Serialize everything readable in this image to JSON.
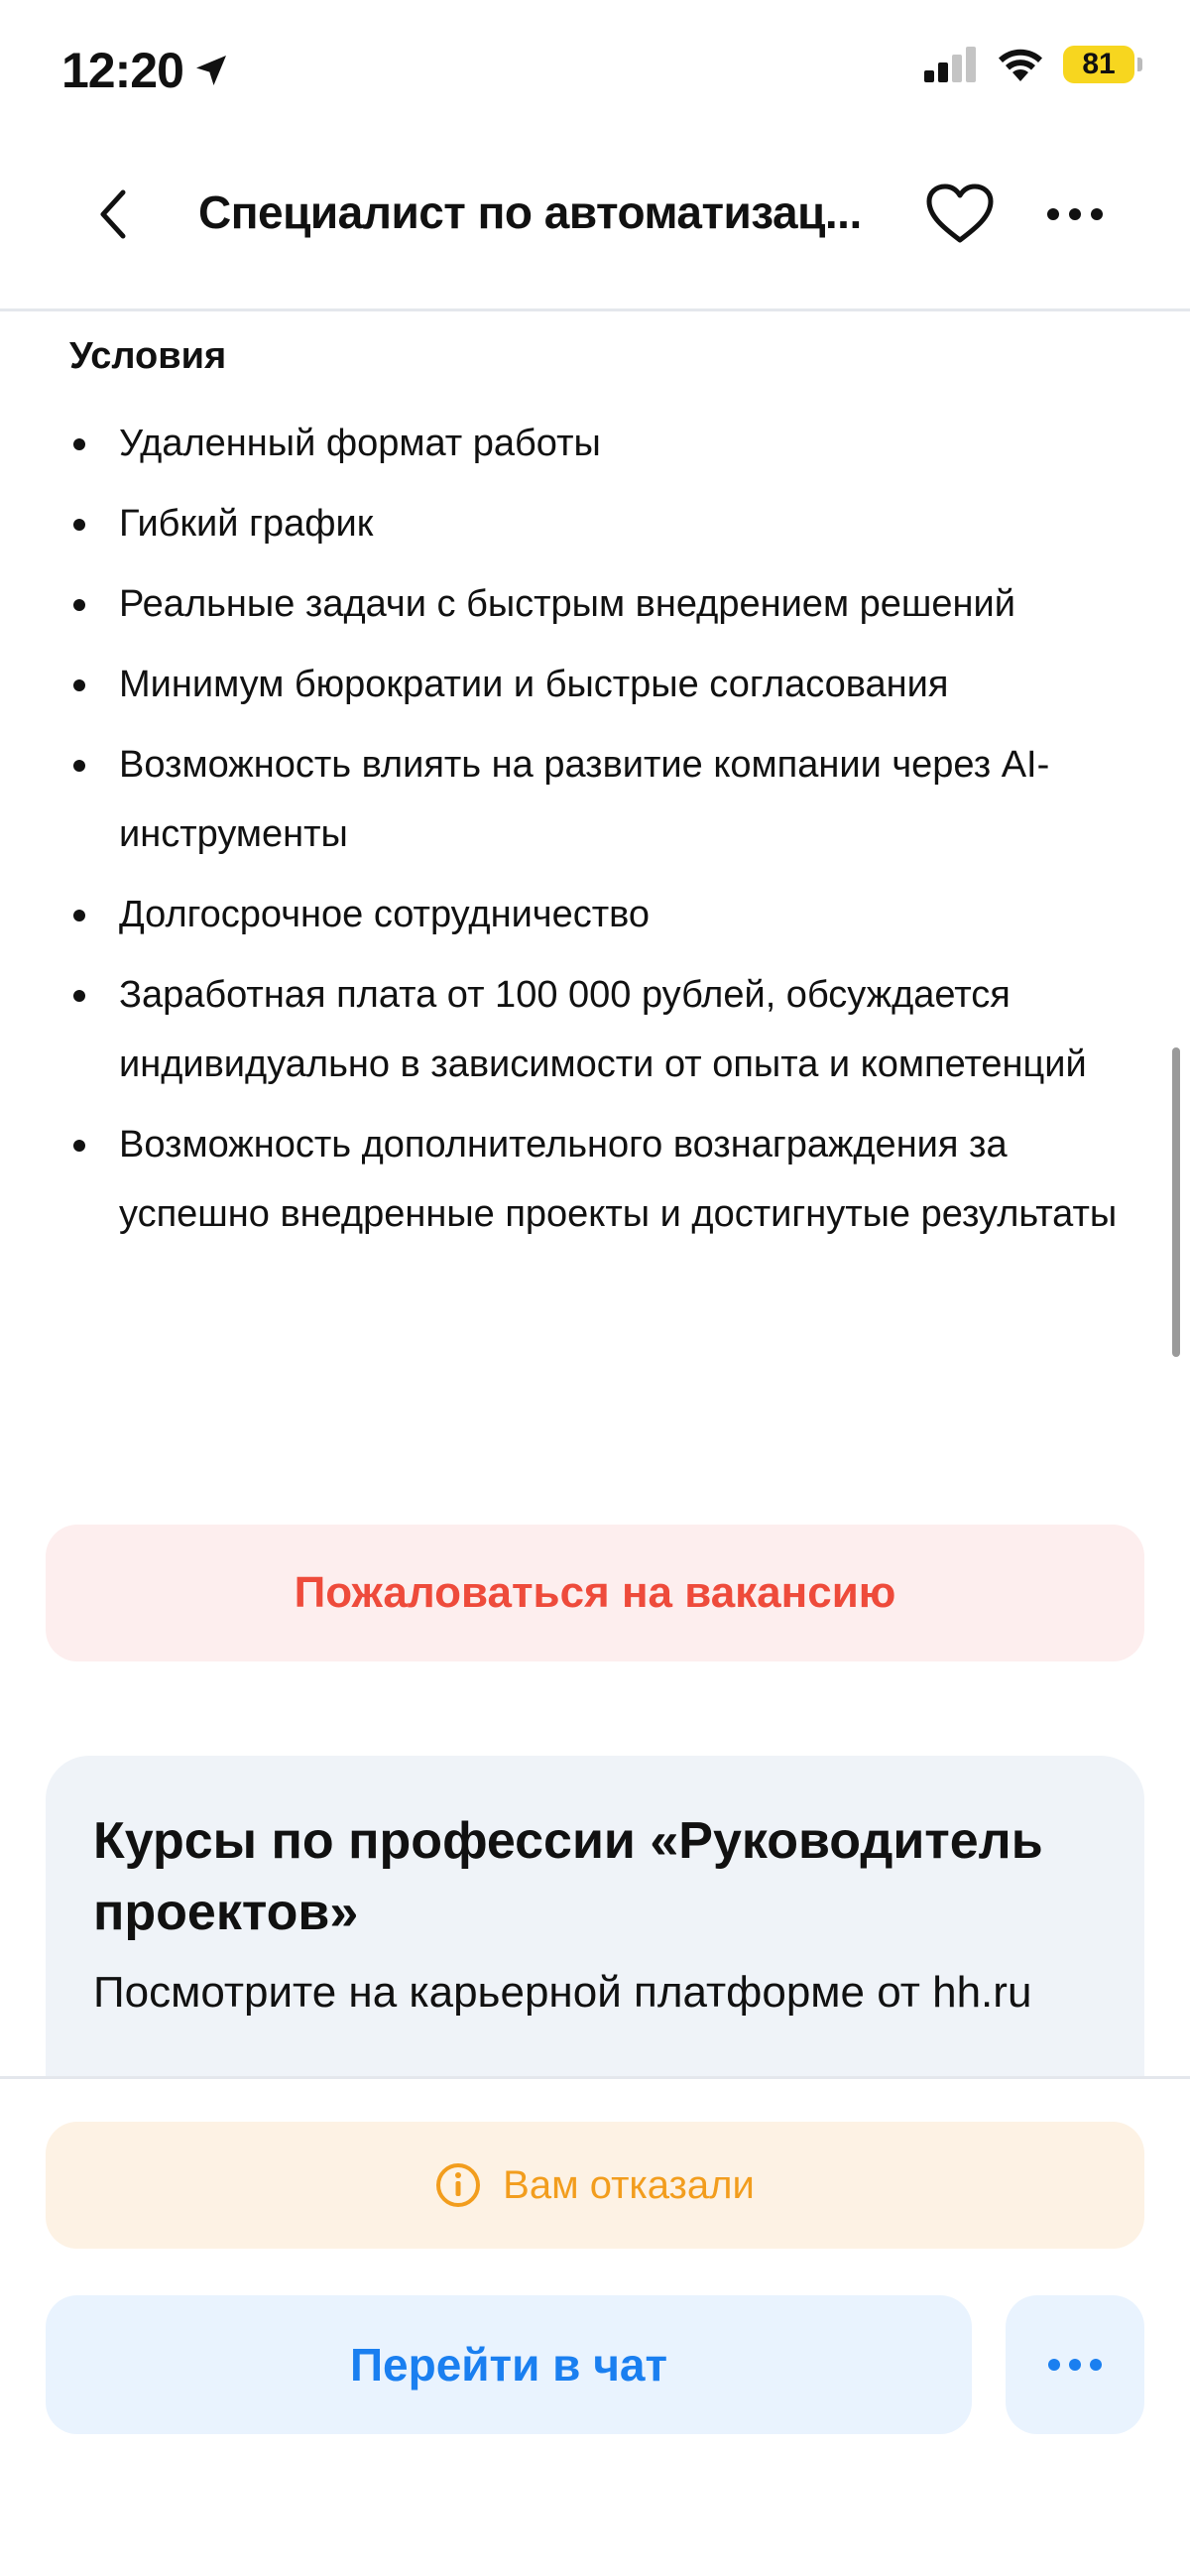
{
  "status_bar": {
    "time": "12:20",
    "battery": "81"
  },
  "header": {
    "title": "Специалист по автоматизац..."
  },
  "conditions": {
    "title": "Условия",
    "items": [
      "Удаленный формат работы",
      "Гибкий график",
      "Реальные задачи с быстрым внедрением решений",
      "Минимум бюрократии и быстрые согласования",
      "Возможность влиять на развитие компании через AI-инструменты",
      "Долгосрочное сотрудничество",
      "Заработная плата от 100 000 рублей, обсуждается индивидуально в зависимости от опыта и компетенций",
      "Возможность дополнительного вознаграждения за успешно внедренные проекты и достигнутые результаты"
    ]
  },
  "report": {
    "label": "Пожаловаться на вакансию"
  },
  "course": {
    "title": "Курсы по профессии «Руководитель проектов»",
    "subtitle": "Посмотрите на карьерной платформе от hh.ru"
  },
  "bottom": {
    "status_label": "Вам отказали",
    "chat_label": "Перейти в чат"
  },
  "colors": {
    "accent_blue": "#1a7ff0",
    "danger_red": "#ee4b3b",
    "warning_orange": "#f29d1d",
    "battery_yellow": "#f7d61f"
  }
}
